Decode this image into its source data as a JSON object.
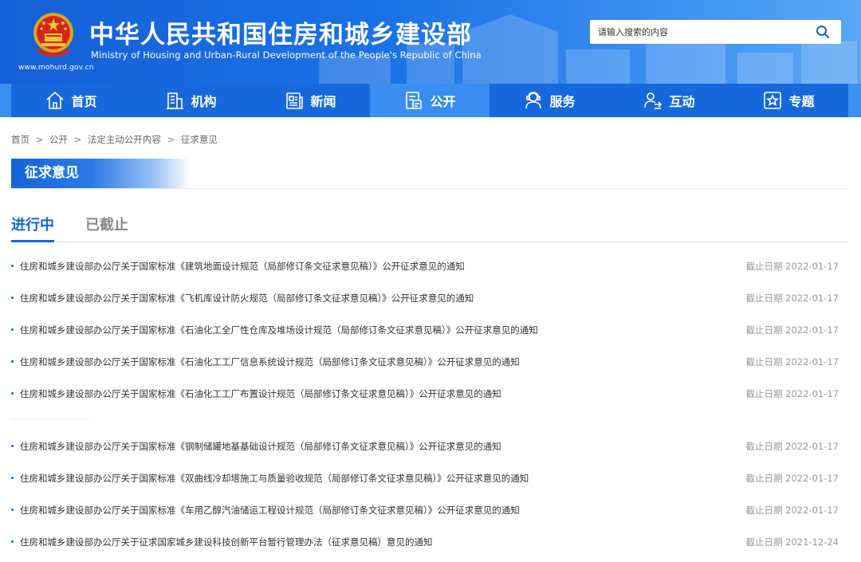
{
  "header": {
    "title_cn": "中华人民共和国住房和城乡建设部",
    "title_en": "Ministry of Housing and Urban-Rural Development of the People's Republic of China",
    "site_url": "www.mohurd.gov.cn",
    "search": {
      "placeholder": "请输入搜索的内容"
    }
  },
  "nav": {
    "items": [
      {
        "label": "首页",
        "icon": "home-icon"
      },
      {
        "label": "机构",
        "icon": "building-icon"
      },
      {
        "label": "新闻",
        "icon": "news-icon"
      },
      {
        "label": "公开",
        "icon": "disclosure-icon",
        "active": true
      },
      {
        "label": "服务",
        "icon": "service-icon"
      },
      {
        "label": "互动",
        "icon": "interaction-icon"
      },
      {
        "label": "专题",
        "icon": "topic-star-icon"
      }
    ]
  },
  "breadcrumb": {
    "items": [
      "首页",
      "公开",
      "法定主动公开内容",
      "征求意见"
    ],
    "separator": ">"
  },
  "section": {
    "title": "征求意见"
  },
  "tabs": {
    "active": "进行中",
    "inactive": "已截止"
  },
  "list": {
    "date_prefix": "截止日期",
    "items": [
      {
        "title": "住房和城乡建设部办公厅关于国家标准《建筑地面设计规范（局部修订条文征求意见稿）》公开征求意见的通知",
        "date": "2022-01-17"
      },
      {
        "title": "住房和城乡建设部办公厅关于国家标准《飞机库设计防火规范（局部修订条文征求意见稿）》公开征求意见的通知",
        "date": "2022-01-17"
      },
      {
        "title": "住房和城乡建设部办公厅关于国家标准《石油化工全厂性仓库及堆场设计规范（局部修订条文征求意见稿）》公开征求意见的通知",
        "date": "2022-01-17"
      },
      {
        "title": "住房和城乡建设部办公厅关于国家标准《石油化工工厂信息系统设计规范（局部修订条文征求意见稿）》公开征求意见的通知",
        "date": "2022-01-17"
      },
      {
        "title": "住房和城乡建设部办公厅关于国家标准《石油化工工厂布置设计规范（局部修订条文征求意见稿）》公开征求意见的通知",
        "date": "2022-01-17"
      },
      {
        "title": "住房和城乡建设部办公厅关于国家标准《钢制储罐地基基础设计规范（局部修订条文征求意见稿）》公开征求意见的通知",
        "date": "2022-01-17"
      },
      {
        "title": "住房和城乡建设部办公厅关于国家标准《双曲线冷却塔施工与质量验收规范（局部修订条文征求意见稿）》公开征求意见的通知",
        "date": "2022-01-17"
      },
      {
        "title": "住房和城乡建设部办公厅关于国家标准《车用乙醇汽油储运工程设计规范（局部修订条文征求意见稿）》公开征求意见的通知",
        "date": "2022-01-17"
      },
      {
        "title": "住房和城乡建设部办公厅关于征求国家城乡建设科技创新平台暂行管理办法（征求意见稿）意见的通知",
        "date": "2021-12-24"
      }
    ]
  },
  "colors": {
    "brand_blue": "#1668dc",
    "nav_active": "#3a8ef2",
    "tab_active": "#1566d6",
    "date_gray": "#999999"
  }
}
